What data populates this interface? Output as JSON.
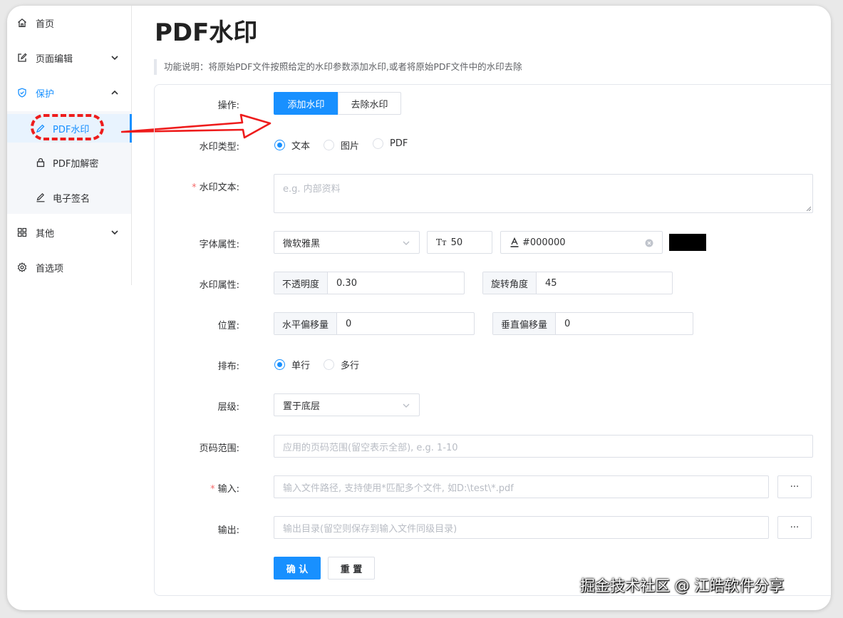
{
  "sidebar": {
    "items": [
      {
        "label": "首页",
        "icon": "home-icon"
      },
      {
        "label": "页面编辑",
        "icon": "edit-icon"
      },
      {
        "label": "保护",
        "icon": "shield-icon"
      },
      {
        "label": "PDF水印",
        "icon": "stamp-icon"
      },
      {
        "label": "PDF加解密",
        "icon": "lock-icon"
      },
      {
        "label": "电子签名",
        "icon": "pen-icon"
      },
      {
        "label": "其他",
        "icon": "grid-icon"
      },
      {
        "label": "首选项",
        "icon": "gear-icon"
      }
    ]
  },
  "page": {
    "title": "PDF水印",
    "description": "功能说明：将原始PDF文件按照给定的水印参数添加水印,或者将原始PDF文件中的水印去除"
  },
  "form": {
    "operation": {
      "label": "操作:",
      "add": "添加水印",
      "remove": "去除水印"
    },
    "watermark_type": {
      "label": "水印类型:",
      "options": [
        "文本",
        "图片",
        "PDF"
      ],
      "selected": "文本"
    },
    "watermark_text": {
      "label": "水印文本:",
      "required_mark": "*",
      "placeholder": "e.g. 内部资料"
    },
    "font": {
      "label": "字体属性:",
      "family": "微软雅黑",
      "size_icon": "Tт",
      "size": "50",
      "color": "#000000",
      "swatch_color": "#000000"
    },
    "props": {
      "label": "水印属性:",
      "opacity_label": "不透明度",
      "opacity": "0.30",
      "rotation_label": "旋转角度",
      "rotation": "45"
    },
    "position": {
      "label": "位置:",
      "h_label": "水平偏移量",
      "h_value": "0",
      "v_label": "垂直偏移量",
      "v_value": "0"
    },
    "layout": {
      "label": "排布:",
      "options": [
        "单行",
        "多行"
      ],
      "selected": "单行"
    },
    "layer": {
      "label": "层级:",
      "value": "置于底层"
    },
    "pages": {
      "label": "页码范围:",
      "placeholder": "应用的页码范围(留空表示全部), e.g. 1-10"
    },
    "input": {
      "label": "输入:",
      "required_mark": "*",
      "placeholder": "输入文件路径, 支持使用*匹配多个文件, 如D:\\test\\*.pdf",
      "browse": "···"
    },
    "output": {
      "label": "输出:",
      "placeholder": "输出目录(留空则保存到输入文件同级目录)",
      "browse": "···"
    },
    "confirm": "确 认",
    "reset": "重 置"
  },
  "watermark_caption": "掘金技术社区 @ 江皓软件分享",
  "colors": {
    "accent": "#1890ff",
    "annotation": "#ee1c1c"
  }
}
